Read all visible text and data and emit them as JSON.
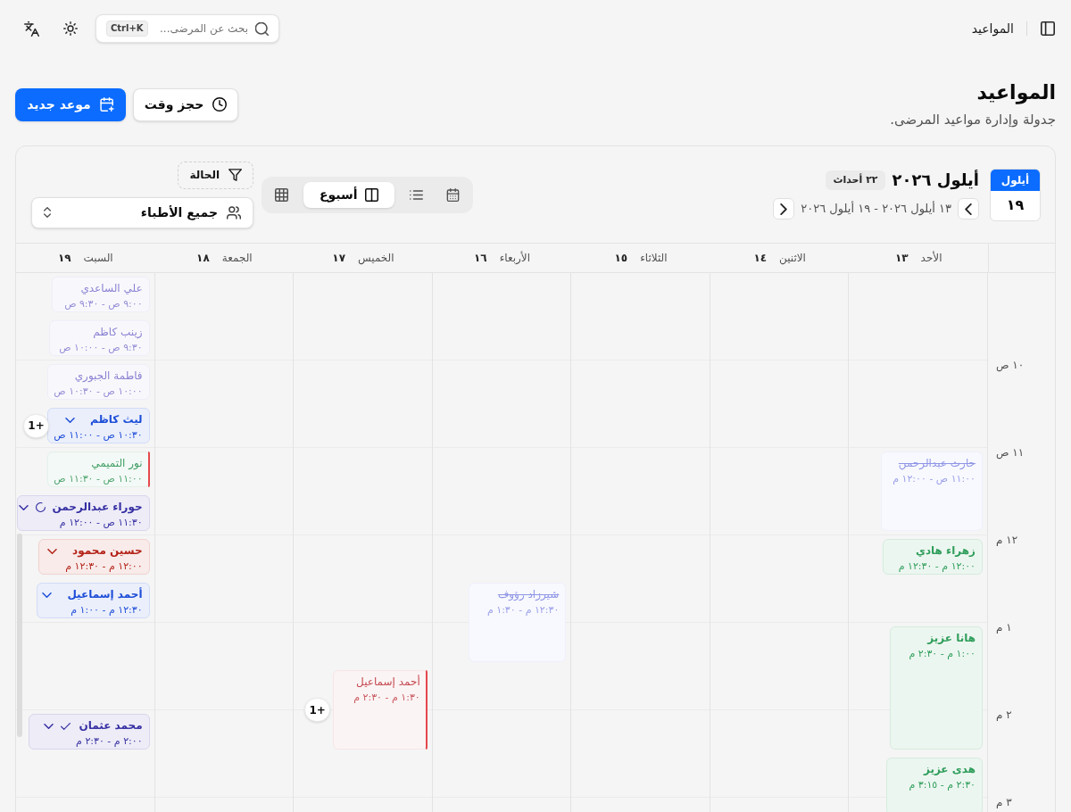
{
  "top_bar": {
    "title": "المواعيد",
    "search": {
      "placeholder": "بحث عن المرضى...",
      "shortcut": "Ctrl+K"
    }
  },
  "header": {
    "title": "المواعيد",
    "subtitle": "جدولة وإدارة مواعيد المرضى.",
    "buttons": [
      {
        "label": "حجز وقت",
        "kind": "outline"
      },
      {
        "label": "موعد جديد",
        "kind": "primary"
      }
    ]
  },
  "calendar": {
    "date_badge": {
      "month": "أيلول",
      "day": "١٩"
    },
    "title": "أيلول ٢٠٢٦",
    "event_count": "٢٢ أحداث",
    "range": "١٣ أيلول ٢٠٢٦ - ١٩ أيلول ٢٠٢٦",
    "views": [
      {
        "selected": false
      },
      {
        "selected": false
      },
      {
        "label": "أسبوع",
        "selected": true
      },
      {
        "selected": false
      }
    ],
    "status_filter": "الحالة",
    "doctor_filter": "جميع الأطباء",
    "time_labels": [
      "١٠ ص",
      "١١ ص",
      "١٢ م",
      "١ م",
      "٢ م",
      "٣ م"
    ],
    "days": [
      {
        "weekday": "الأحد",
        "date": "١٣",
        "events": [
          {
            "kind": "cancelled",
            "name": "حارث عبدالرحمن",
            "time": "١١:٠٠ ص - ١٢:٠٠ م",
            "color": "#9096e6",
            "flagged": false,
            "menu": false
          },
          {
            "kind": "upcoming",
            "name": "زهراء هادي",
            "time": "١٢:٠٠ م - ١٢:٣٠ م",
            "color": "#2f9e5b",
            "flagged": false,
            "menu": false
          },
          {
            "kind": "upcoming",
            "name": "هانا عزيز",
            "time": "١:٠٠ م - ٢:٣٠ م",
            "color": "#2f9e5b",
            "flagged": false,
            "menu": false
          },
          {
            "kind": "upcoming",
            "name": "هدى عزيز",
            "time": "٢:٣٠ م - ٣:١٥ م",
            "color": "#2f9e5b",
            "flagged": false,
            "menu": false
          }
        ]
      },
      {
        "weekday": "الاثنين",
        "date": "١٤"
      },
      {
        "weekday": "الثلاثاء",
        "date": "١٥"
      },
      {
        "weekday": "الأربعاء",
        "date": "١٦",
        "events": [
          {
            "kind": "cancelled",
            "name": "شيرزاد رؤوف",
            "time": "١٢:٣٠ م - ١:٣٠ م",
            "color": "#9096e6",
            "flagged": false,
            "menu": false
          }
        ]
      },
      {
        "weekday": "الخميس",
        "date": "١٧",
        "events": [
          {
            "kind": "past",
            "name": "أحمد إسماعيل",
            "time": "١:٣٠ م - ٢:٣٠ م",
            "color": "#c4474f",
            "flagged": true,
            "menu": false,
            "more": "+1"
          }
        ]
      },
      {
        "weekday": "الجمعة",
        "date": "١٨"
      },
      {
        "weekday": "السبت",
        "date": "١٩",
        "events": [
          {
            "kind": "past",
            "name": "علي الساعدي",
            "time": "٩:٠٠ ص - ٩:٣٠ ص",
            "color": "#8a82d2",
            "flagged": false,
            "menu": false
          },
          {
            "kind": "past",
            "name": "زينب كاظم",
            "time": "٩:٣٠ ص - ١٠:٠٠ ص",
            "color": "#8a82d2",
            "flagged": false,
            "menu": false
          },
          {
            "kind": "past",
            "name": "فاطمة الجبوري",
            "time": "١٠:٠٠ ص - ١٠:٣٠ ص",
            "color": "#8a82d2",
            "flagged": false,
            "menu": false
          },
          {
            "kind": "upcoming",
            "name": "ليث كاظم",
            "time": "١٠:٣٠ ص - ١١:٠٠ ص",
            "color": "#1d4ed8",
            "flagged": false,
            "menu": true,
            "more": "+1"
          },
          {
            "kind": "past",
            "name": "نور التميمي",
            "time": "١١:٠٠ ص - ١١:٣٠ ص",
            "color": "#3f9e63",
            "flagged": true,
            "menu": false
          },
          {
            "kind": "in_progress",
            "name": "حوراء عبدالرحمن",
            "time": "١١:٣٠ ص - ١٢:٠٠ م",
            "color": "#3730a3",
            "flagged": false,
            "menu": true
          },
          {
            "kind": "upcoming",
            "name": "حسين محمود",
            "time": "١٢:٠٠ م - ١٢:٣٠ م",
            "color": "#b42318",
            "flagged": false,
            "menu": true
          },
          {
            "kind": "upcoming",
            "name": "أحمد إسماعيل",
            "time": "١٢:٣٠ م - ١:٠٠ م",
            "color": "#1d4ed8",
            "flagged": false,
            "menu": true
          },
          {
            "kind": "confirmed",
            "name": "محمد عثمان",
            "time": "٢:٠٠ م - ٢:٣٠ م",
            "color": "#3730a3",
            "flagged": false,
            "menu": true
          }
        ]
      }
    ]
  }
}
